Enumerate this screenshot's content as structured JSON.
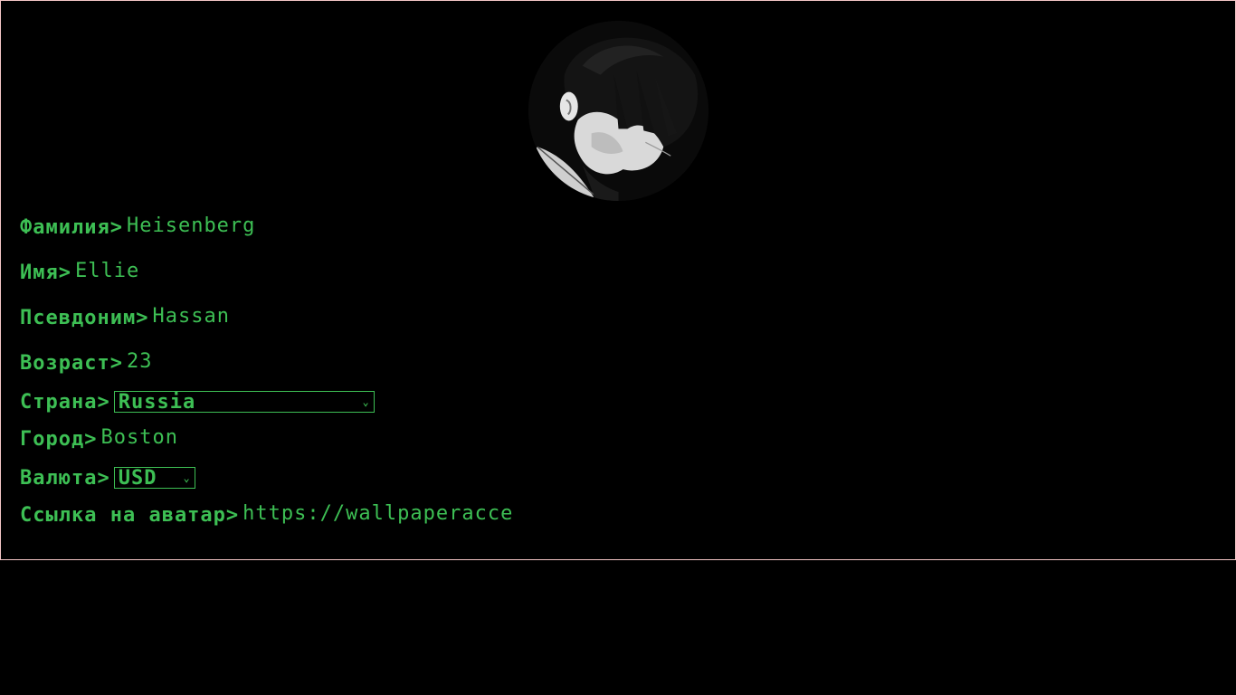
{
  "profile": {
    "avatar_icon": "avatar-image",
    "fields": {
      "surname": {
        "label": "Фамилия",
        "prompt": ">",
        "value": "Heisenberg"
      },
      "name": {
        "label": "Имя",
        "prompt": ">",
        "value": "Ellie"
      },
      "nickname": {
        "label": "Псевдоним",
        "prompt": ">",
        "value": "Hassan"
      },
      "age": {
        "label": "Возраст",
        "prompt": ">",
        "value": "23"
      },
      "country": {
        "label": "Страна",
        "prompt": ">",
        "selected": "Russia"
      },
      "city": {
        "label": "Город",
        "prompt": ">",
        "value": "Boston"
      },
      "currency": {
        "label": "Валюта",
        "prompt": ">",
        "selected": "USD"
      },
      "avatar_link": {
        "label": "Ссылка на аватар",
        "prompt": ">",
        "value": "https://wallpaperacce"
      }
    }
  },
  "colors": {
    "accent": "#3dbf54",
    "background": "#000000",
    "frame_border": "#f4c6c6"
  }
}
